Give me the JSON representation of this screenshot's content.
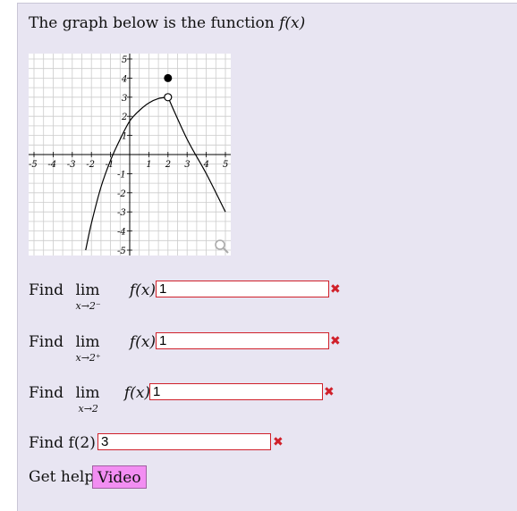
{
  "intro": {
    "text": "The graph below is the function ",
    "func": "f(x)"
  },
  "chart_data": {
    "type": "line",
    "xlim": [
      -5,
      5
    ],
    "ylim": [
      -5,
      5
    ],
    "grid": true,
    "x_ticks": [
      "-5",
      "-4",
      "-3",
      "-2",
      "-1",
      "1",
      "2",
      "3",
      "4",
      "5"
    ],
    "y_ticks": [
      "5",
      "4",
      "3",
      "2",
      "1",
      "-1",
      "-2",
      "-3",
      "-4",
      "-5"
    ],
    "series": [
      {
        "points": [
          [
            -2.3,
            -5
          ],
          [
            -2,
            -3.6
          ],
          [
            -1.5,
            -1.7
          ],
          [
            -1,
            -0.3
          ],
          [
            -0.5,
            0.8
          ],
          [
            0,
            1.75
          ],
          [
            0.5,
            2.3
          ],
          [
            1,
            2.7
          ],
          [
            1.5,
            2.93
          ],
          [
            2,
            3
          ]
        ]
      },
      {
        "points": [
          [
            2,
            3
          ],
          [
            3,
            0.8
          ],
          [
            4,
            -1
          ],
          [
            5,
            -3
          ]
        ]
      }
    ],
    "open_points": [
      [
        2,
        3
      ]
    ],
    "closed_points": [
      [
        2,
        4
      ]
    ]
  },
  "questions": [
    {
      "find": "Find",
      "lim": "lim",
      "sub": "x→2⁻",
      "func": "f(x)",
      "answer": "1"
    },
    {
      "find": "Find",
      "lim": "lim",
      "sub": "x→2⁺",
      "func": "f(x)",
      "answer": "1"
    },
    {
      "find": "Find",
      "lim": "lim",
      "sub": "x→2",
      "func": "f(x)",
      "answer": "1"
    }
  ],
  "q4": {
    "label": "Find f(2)",
    "answer": "3"
  },
  "help": {
    "label": "Get help:",
    "video": "Video"
  },
  "mark": "✖",
  "colors": {
    "error": "#d0202a",
    "video_bg": "#f28ef2",
    "panel": "#e8e5f2"
  },
  "icons": {
    "zoom": "magnifier-icon",
    "wrong": "x-mark-icon"
  }
}
